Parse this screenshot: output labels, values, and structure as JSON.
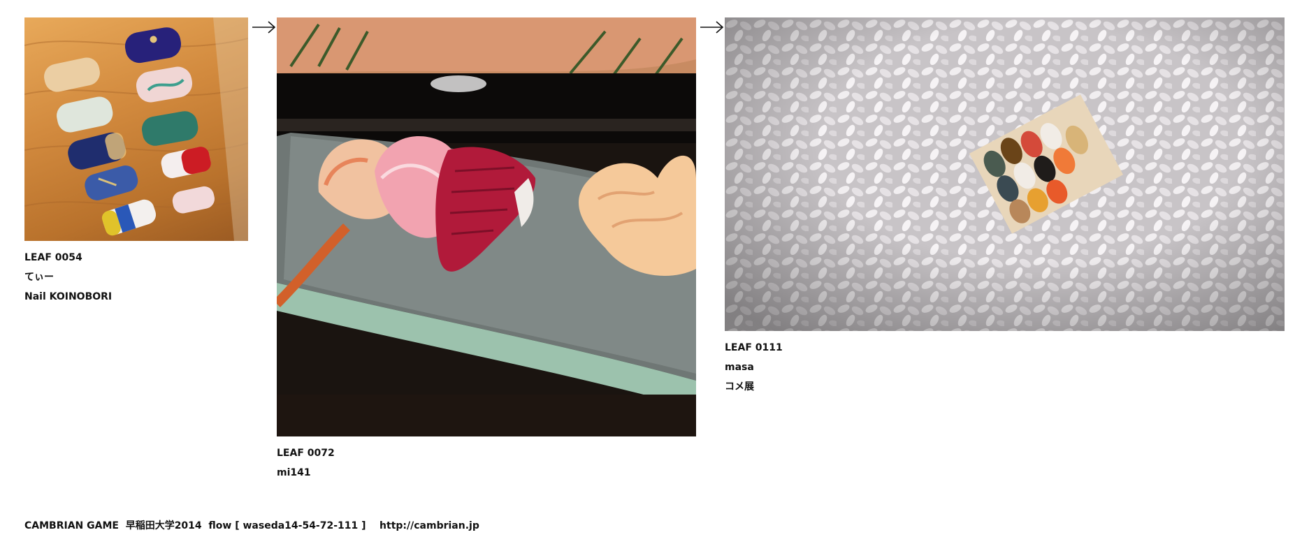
{
  "leaves": [
    {
      "number": "LEAF 0054",
      "author": "てぃー",
      "title": "Nail KOINOBORI",
      "image_alt": "Nail tips arranged on a wooden board"
    },
    {
      "number": "LEAF 0072",
      "author": "mi141",
      "image_alt": "Nigiri sushi on a glass plate"
    },
    {
      "number": "LEAF 0111",
      "author": "masa",
      "title": "コメ展",
      "image_alt": "Miniature sushi on rice grains"
    }
  ],
  "arrows": [
    "arrow-right-icon",
    "arrow-right-icon"
  ],
  "footer": {
    "text": "CAMBRIAN GAME  早稲田大学2014  flow [ waseda14-54-72-111 ]    http://cambrian.jp"
  },
  "colors": {
    "background": "#ffffff",
    "text": "#111111"
  }
}
